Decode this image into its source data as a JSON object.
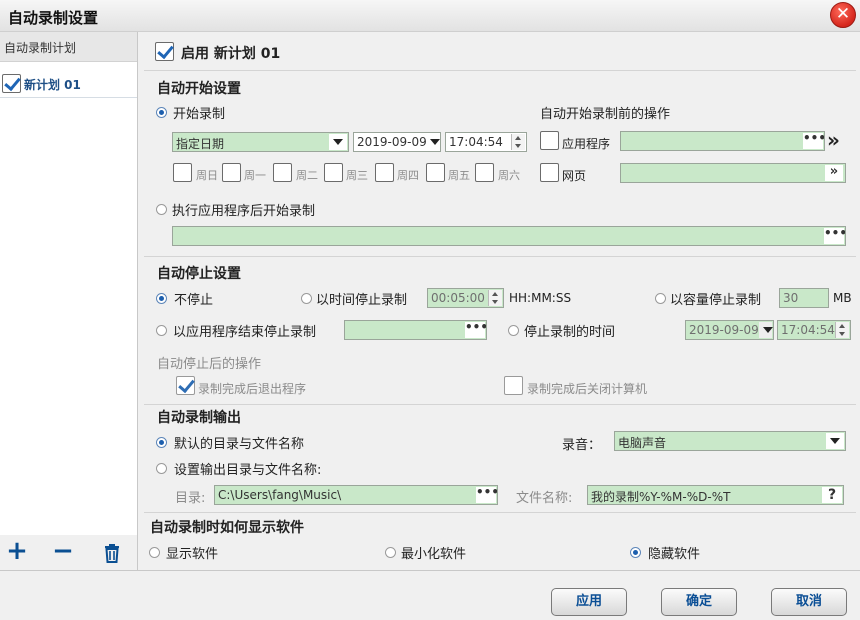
{
  "window": {
    "title": "自动录制设置",
    "close_glyph": "✕"
  },
  "sidebar": {
    "header": "自动录制计划",
    "items": [
      {
        "label": "新计划 01",
        "checked": true
      }
    ],
    "tools": {
      "add": "+",
      "remove": "−",
      "delete_icon": "trash-icon"
    }
  },
  "plan": {
    "enable_label": "启用 新计划 01",
    "enabled": true
  },
  "auto_start": {
    "section_title": "自动开始设置",
    "start_record_label": "开始录制",
    "date_mode": "指定日期",
    "date": "2019-09-09",
    "time": "17:04:54",
    "days": [
      "周日",
      "周一",
      "周二",
      "周三",
      "周四",
      "周五",
      "周六"
    ],
    "pre_ops_title": "自动开始录制前的操作",
    "app_label": "应用程序",
    "web_label": "网页",
    "after_app_label": "执行应用程序后开始录制",
    "dots": "•••",
    "go": "»"
  },
  "auto_stop": {
    "section_title": "自动停止设置",
    "no_stop_label": "不停止",
    "by_time_label": "以时间停止录制",
    "time_value": "00:05:00",
    "time_format": "HH:MM:SS",
    "by_size_label": "以容量停止录制",
    "size_value": "30",
    "size_unit": "MB",
    "by_app_label": "以应用程序结束停止录制",
    "stop_time_label": "停止录制的时间",
    "stop_date": "2019-09-09",
    "stop_time": "17:04:54",
    "after_title": "自动停止后的操作",
    "exit_label": "录制完成后退出程序",
    "exit_checked": true,
    "shutdown_label": "录制完成后关闭计算机",
    "shutdown_checked": false
  },
  "output": {
    "section_title": "自动录制输出",
    "default_label": "默认的目录与文件名称",
    "custom_label": "设置输出目录与文件名称:",
    "audio_label": "录音：",
    "audio_value": "电脑声音",
    "dir_label": "目录:",
    "dir_value": "C:\\Users\\fang\\Music\\",
    "filename_label": "文件名称:",
    "filename_value": "我的录制%Y-%M-%D-%T",
    "help": "?"
  },
  "display": {
    "section_title": "自动录制时如何显示软件",
    "show_label": "显示软件",
    "minimize_label": "最小化软件",
    "hide_label": "隐藏软件",
    "selected": "hide"
  },
  "buttons": {
    "apply": "应用",
    "ok": "确定",
    "cancel": "取消"
  },
  "colors": {
    "field_bg": "#c9e8c9",
    "accent": "#1d5fae",
    "close_red": "#d5261c"
  }
}
